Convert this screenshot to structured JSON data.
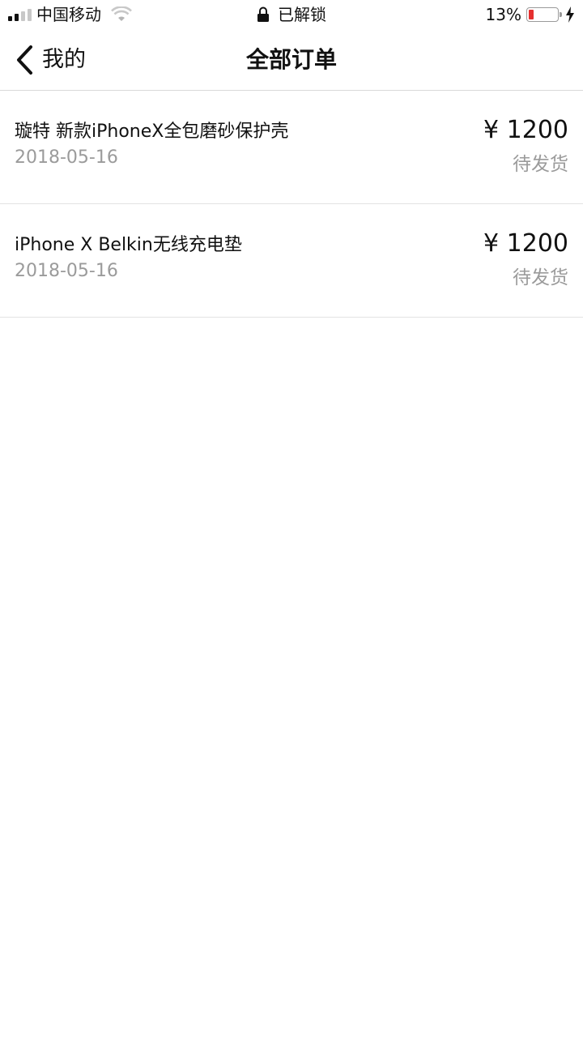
{
  "status_bar": {
    "carrier": "中国移动",
    "lock_text": "已解锁",
    "battery_percent": "13%",
    "battery_color": "#e5302f"
  },
  "nav": {
    "back_label": "我的",
    "title": "全部订单"
  },
  "orders": [
    {
      "name": "璇特 新款iPhoneX全包磨砂保护壳",
      "date": "2018-05-16",
      "price": "¥ 1200",
      "status": "待发货"
    },
    {
      "name": "iPhone X  Belkin无线充电垫",
      "date": "2018-05-16",
      "price": "¥ 1200",
      "status": "待发货"
    }
  ],
  "icons": {
    "signal": "signal-icon",
    "wifi": "wifi-icon",
    "lock": "lock-icon",
    "battery": "battery-icon",
    "charging": "charging-bolt-icon",
    "back": "chevron-left-icon"
  }
}
